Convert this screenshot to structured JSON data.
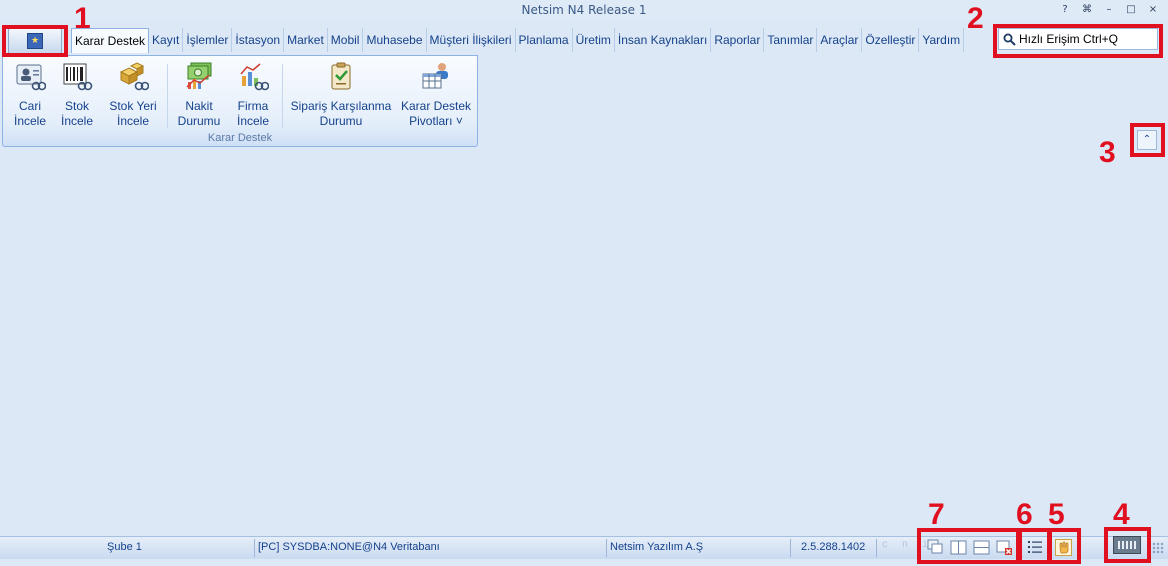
{
  "window": {
    "title": "Netsim N4 Release 1",
    "controls": [
      "?",
      "⌘",
      "–",
      "□",
      "×"
    ]
  },
  "tabs": [
    "Karar Destek",
    "Kayıt",
    "İşlemler",
    "İstasyon",
    "Market",
    "Mobil",
    "Muhasebe",
    "Müşteri İlişkileri",
    "Planlama",
    "Üretim",
    "İnsan Kaynakları",
    "Raporlar",
    "Tanımlar",
    "Araçlar",
    "Özelleştir",
    "Yardım"
  ],
  "active_tab": "Karar Destek",
  "search": {
    "label": "Hızlı Erişim Ctrl+Q"
  },
  "ribbon": {
    "group_label": "Karar Destek",
    "buttons": [
      {
        "line1": "Cari",
        "line2": "İncele",
        "icon": "customer-card-icon"
      },
      {
        "line1": "Stok",
        "line2": "İncele",
        "icon": "barcode-icon"
      },
      {
        "line1": "Stok Yeri",
        "line2": "İncele",
        "icon": "boxes-icon"
      },
      {
        "line1": "Nakit",
        "line2": "Durumu",
        "icon": "cash-chart-icon"
      },
      {
        "line1": "Firma",
        "line2": "İncele",
        "icon": "company-chart-icon"
      },
      {
        "line1": "Sipariş Karşılanma",
        "line2": "Durumu",
        "icon": "clipboard-check-icon"
      },
      {
        "line1": "Karar Destek",
        "line2": "Pivotları ˅",
        "icon": "pivot-table-icon"
      }
    ]
  },
  "annotations": [
    "1",
    "2",
    "3",
    "4",
    "5",
    "6",
    "7"
  ],
  "status": {
    "branch": "Şube 1",
    "connection": "[PC] SYSDBA:NONE@N4 Veritabanı",
    "company": "Netsim Yazılım A.Ş",
    "version": "2.5.288.1402",
    "indicators": "c n i"
  },
  "colors": {
    "annotation_red": "#e01020",
    "ribbon_bg": "#dce8f6",
    "text": "#15428b"
  }
}
